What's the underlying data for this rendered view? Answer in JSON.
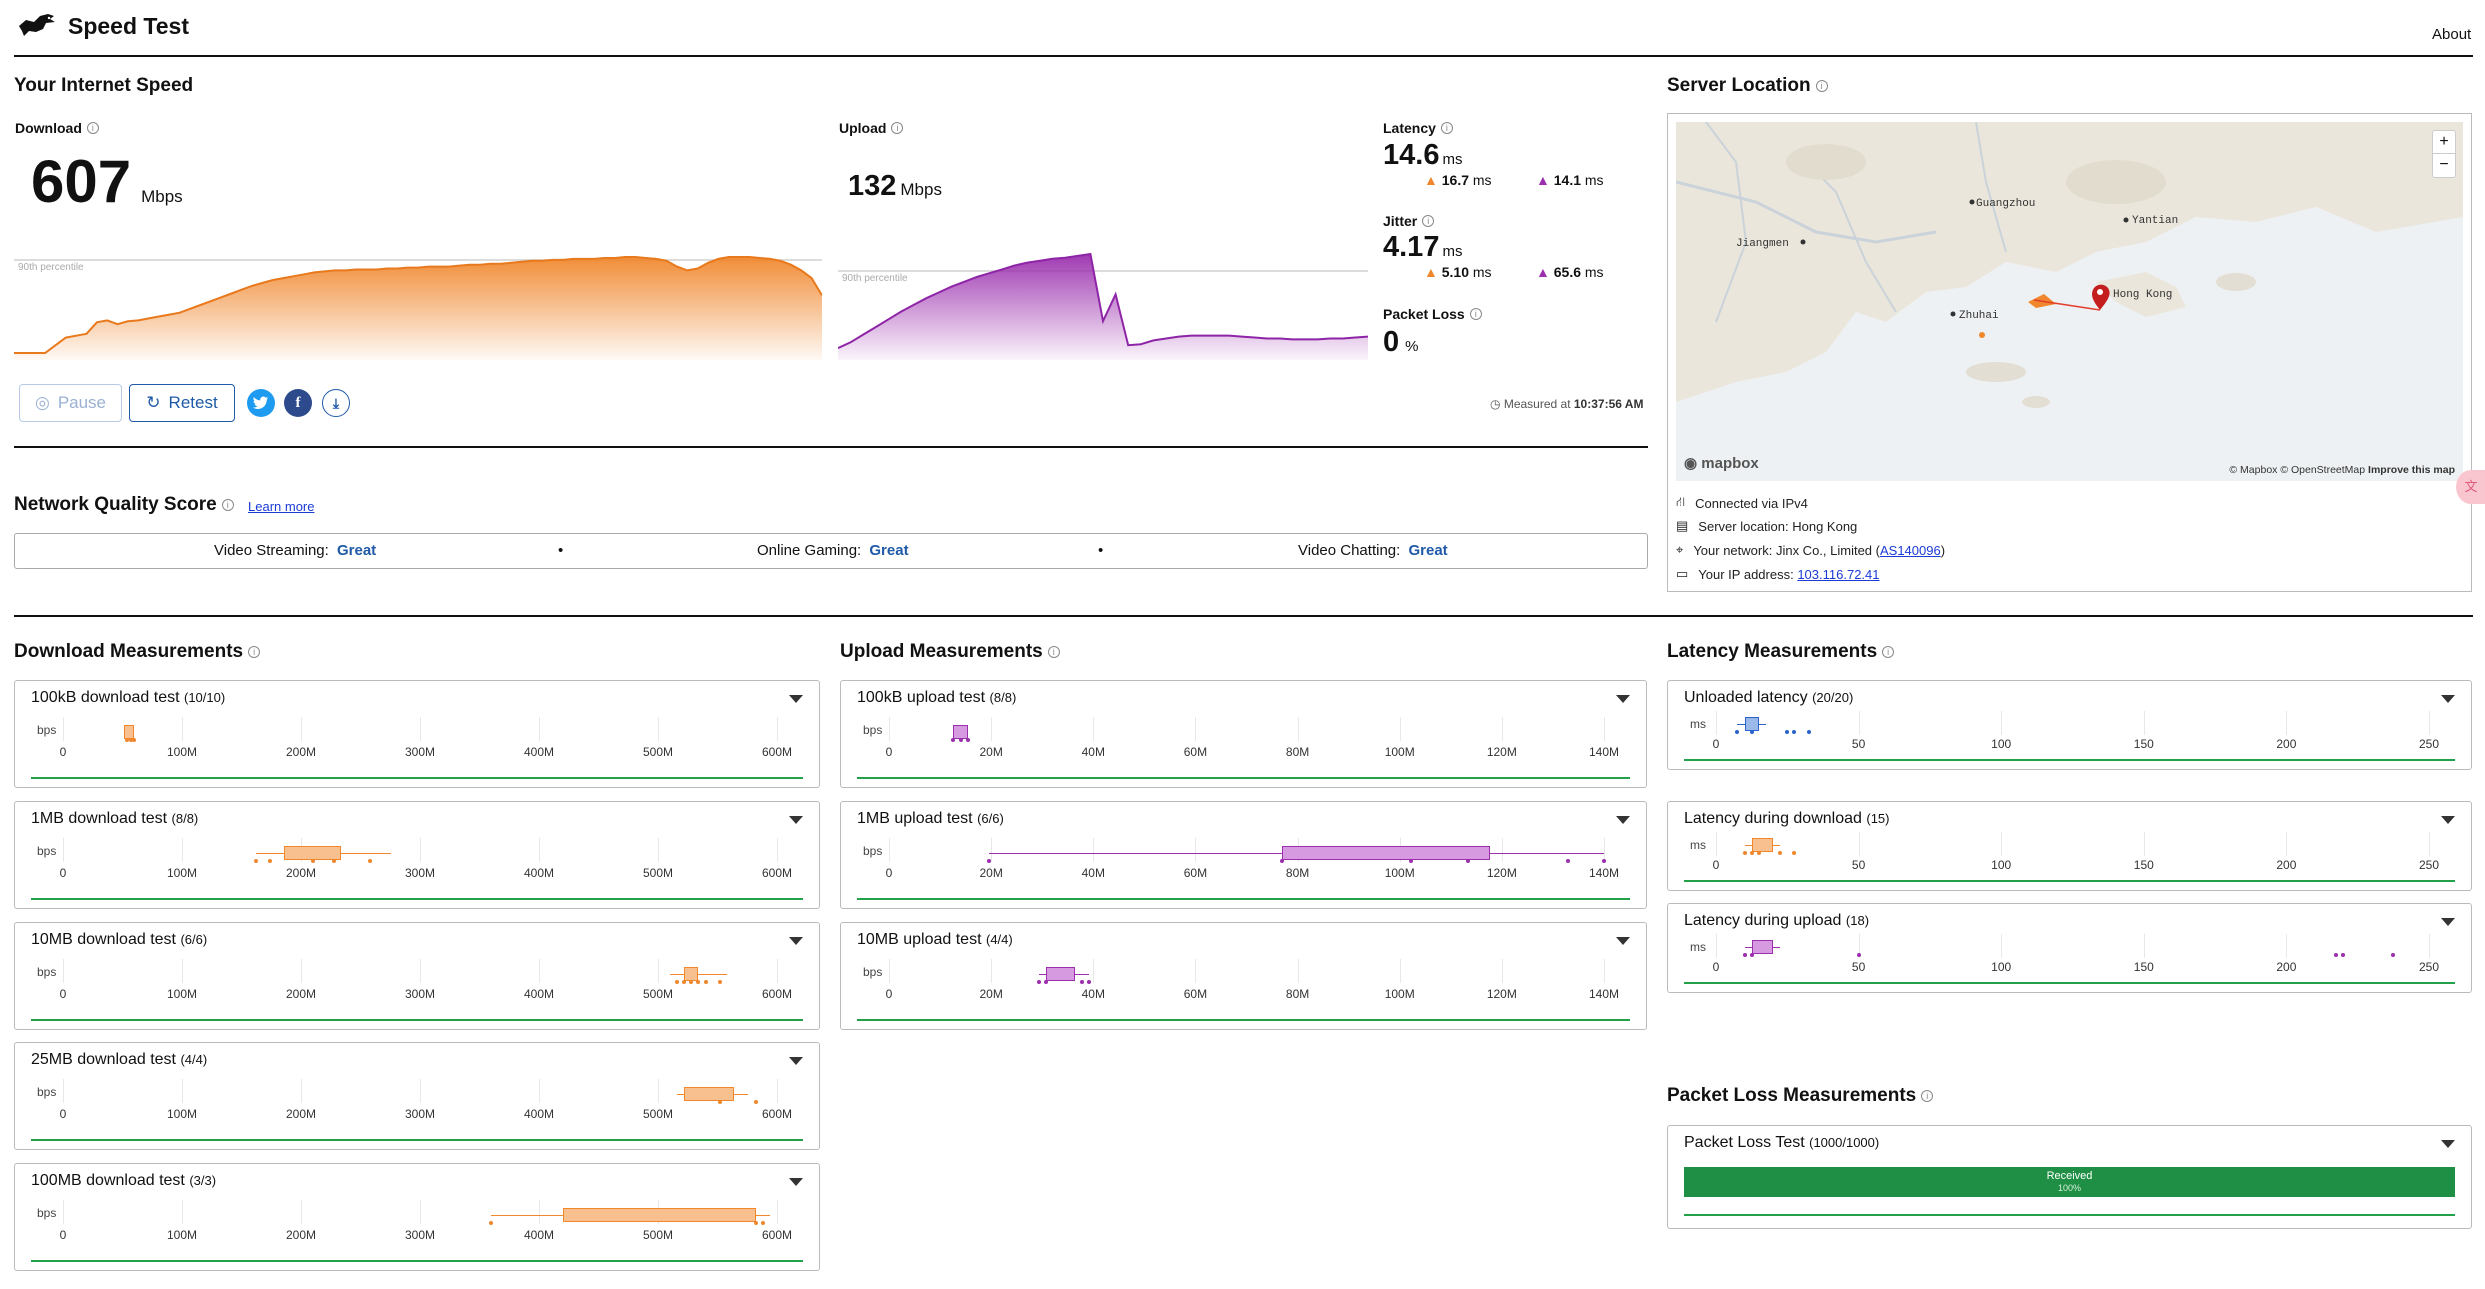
{
  "app": {
    "title": "Speed Test",
    "about": "About"
  },
  "speed": {
    "heading": "Your Internet Speed",
    "download_label": "Download",
    "download_value": "607",
    "download_unit": "Mbps",
    "upload_label": "Upload",
    "upload_value": "132",
    "upload_unit": "Mbps",
    "percentile_label": "90th percentile",
    "latency_label": "Latency",
    "latency_value": "14.6",
    "latency_unit": "ms",
    "latency_down": "16.7",
    "latency_up": "14.1",
    "jitter_label": "Jitter",
    "jitter_value": "4.17",
    "jitter_unit": "ms",
    "jitter_down": "5.10",
    "jitter_up": "65.6",
    "loss_label": "Packet Loss",
    "loss_value": "0",
    "loss_unit": "%",
    "small_unit": "ms",
    "pause": "Pause",
    "retest": "Retest",
    "measured_prefix": "Measured at",
    "measured_time": "10:37:56 AM",
    "download_curve": [
      0.0,
      0.0,
      0.0,
      0.0,
      0.08,
      0.16,
      0.18,
      0.2,
      0.32,
      0.34,
      0.3,
      0.33,
      0.34,
      0.36,
      0.38,
      0.4,
      0.42,
      0.46,
      0.5,
      0.54,
      0.58,
      0.62,
      0.66,
      0.7,
      0.73,
      0.76,
      0.78,
      0.8,
      0.82,
      0.84,
      0.85,
      0.86,
      0.86,
      0.87,
      0.87,
      0.87,
      0.88,
      0.88,
      0.89,
      0.89,
      0.9,
      0.9,
      0.9,
      0.91,
      0.92,
      0.92,
      0.93,
      0.93,
      0.94,
      0.95,
      0.96,
      0.96,
      0.97,
      0.97,
      0.98,
      0.98,
      0.98,
      0.99,
      0.99,
      1.0,
      1.0,
      0.99,
      0.98,
      0.96,
      0.9,
      0.86,
      0.88,
      0.94,
      0.98,
      1.0,
      1.0,
      1.0,
      0.99,
      0.98,
      0.96,
      0.92,
      0.86,
      0.78,
      0.6
    ],
    "upload_curve": [
      0.02,
      0.08,
      0.16,
      0.24,
      0.32,
      0.4,
      0.47,
      0.54,
      0.6,
      0.66,
      0.71,
      0.76,
      0.8,
      0.84,
      0.88,
      0.91,
      0.93,
      0.95,
      0.96,
      0.98,
      1.0,
      0.3,
      0.58,
      0.05,
      0.06,
      0.1,
      0.12,
      0.14,
      0.15,
      0.15,
      0.15,
      0.15,
      0.14,
      0.13,
      0.12,
      0.12,
      0.11,
      0.11,
      0.11,
      0.12,
      0.12,
      0.13,
      0.14
    ]
  },
  "server": {
    "heading": "Server Location",
    "labels": {
      "guangzhou": "Guangzhou",
      "yantian": "Yantian",
      "jiangmen": "Jiangmen",
      "zhuhai": "Zhuhai",
      "hongkong": "Hong Kong"
    },
    "zoom_in": "+",
    "zoom_out": "−",
    "logo": "mapbox",
    "attribution": "© Mapbox © OpenStreetMap",
    "improve": "Improve this map",
    "connected": "Connected via IPv4",
    "location": "Server location: Hong Kong",
    "network_prefix": "Your network: Jinx Co., Limited (",
    "network_as": "AS140096",
    "network_suffix": ")",
    "ip_prefix": "Your IP address:",
    "ip": "103.116.72.41"
  },
  "quality": {
    "heading": "Network Quality Score",
    "learn_more": "Learn more",
    "items": [
      {
        "label": "Video Streaming:",
        "value": "Great"
      },
      {
        "label": "Online Gaming:",
        "value": "Great"
      },
      {
        "label": "Video Chatting:",
        "value": "Great"
      }
    ],
    "separator": "•"
  },
  "download_measurements": {
    "heading": "Download Measurements",
    "unit": "bps",
    "ticks": [
      "0",
      "100M",
      "200M",
      "300M",
      "400M",
      "500M",
      "600M"
    ],
    "tests": [
      {
        "name": "100kB download test",
        "count": "(10/10)"
      },
      {
        "name": "1MB download test",
        "count": "(8/8)"
      },
      {
        "name": "10MB download test",
        "count": "(6/6)"
      },
      {
        "name": "25MB download test",
        "count": "(4/4)"
      },
      {
        "name": "100MB download test",
        "count": "(3/3)"
      }
    ]
  },
  "upload_measurements": {
    "heading": "Upload Measurements",
    "unit": "bps",
    "ticks": [
      "0",
      "20M",
      "40M",
      "60M",
      "80M",
      "100M",
      "120M",
      "140M"
    ],
    "tests": [
      {
        "name": "100kB upload test",
        "count": "(8/8)"
      },
      {
        "name": "1MB upload test",
        "count": "(6/6)"
      },
      {
        "name": "10MB upload test",
        "count": "(4/4)"
      }
    ]
  },
  "latency_measurements": {
    "heading": "Latency Measurements",
    "unit": "ms",
    "ticks": [
      "0",
      "50",
      "100",
      "150",
      "200",
      "250"
    ],
    "tests": [
      {
        "name": "Unloaded latency",
        "count": "(20/20)"
      },
      {
        "name": "Latency during download",
        "count": "(15)"
      },
      {
        "name": "Latency during upload",
        "count": "(18)"
      }
    ]
  },
  "packet_loss": {
    "heading": "Packet Loss Measurements",
    "test_name": "Packet Loss Test",
    "test_count": "(1000/1000)",
    "bar_label": "Received",
    "bar_pct": "100%",
    "received_fraction": 1.0
  },
  "colors": {
    "download": "#f0872d",
    "upload": "#9b2fae",
    "latency": "#2a63c9",
    "great": "#1f5aa8",
    "green": "#23a04a"
  }
}
